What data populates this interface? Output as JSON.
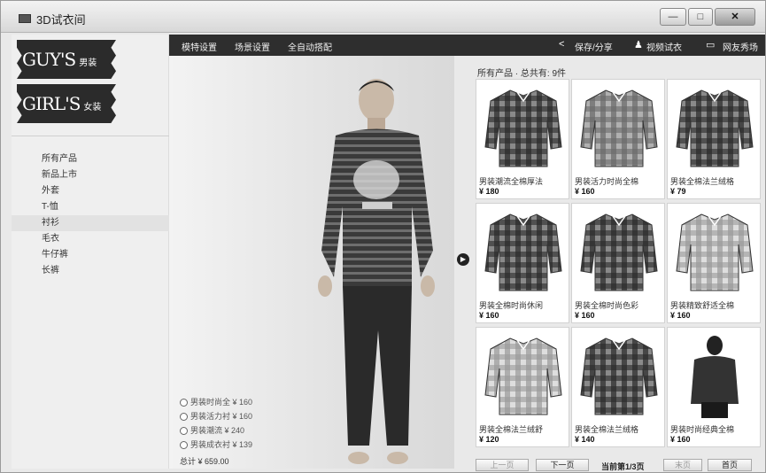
{
  "window": {
    "title": "3D试衣间",
    "min": "—",
    "max": "□",
    "close": "✕"
  },
  "brands": [
    {
      "name": "GUY'S",
      "sub": "男装"
    },
    {
      "name": "GIRL'S",
      "sub": "女装"
    }
  ],
  "categories": [
    "所有产品",
    "新品上市",
    "外套",
    "T-恤",
    "衬衫",
    "毛衣",
    "牛仔裤",
    "长裤"
  ],
  "active_category": "衬衫",
  "toolbar": {
    "items": [
      "模特设置",
      "场景设置",
      "全自动搭配"
    ],
    "share": "保存/分享",
    "video": "视频试衣",
    "friends": "网友秀场"
  },
  "outfit": {
    "items": [
      "男装时尚全 ¥ 160",
      "男装活力衬 ¥ 160",
      "男装潮流 ¥ 240",
      "男装成衣衬 ¥ 139"
    ],
    "total": "总计 ¥ 659.00"
  },
  "products": {
    "header": "所有产品 · 总共有: 9件",
    "items": [
      {
        "name": "男装潮流全棉厚法",
        "price": "¥ 180",
        "tone": "dark"
      },
      {
        "name": "男装活力时尚全棉",
        "price": "¥ 160",
        "tone": "mid"
      },
      {
        "name": "男装全棉法兰绒格",
        "price": "¥ 79",
        "tone": "dark"
      },
      {
        "name": "男装全棉时尚休闲",
        "price": "¥ 160",
        "tone": "dark"
      },
      {
        "name": "男装全棉时尚色彩",
        "price": "¥ 160",
        "tone": "dark"
      },
      {
        "name": "男装精致舒适全棉",
        "price": "¥ 160",
        "tone": "light"
      },
      {
        "name": "男装全棉法兰绒舒",
        "price": "¥ 120",
        "tone": "light"
      },
      {
        "name": "男装全棉法兰绒格",
        "price": "¥ 140",
        "tone": "dark"
      },
      {
        "name": "男装时尚经典全棉",
        "price": "¥ 160",
        "tone": "model"
      }
    ]
  },
  "pager": {
    "prev": "上一页",
    "next": "下一页",
    "info": "当前第1/3页",
    "last": "末页",
    "first": "首页"
  }
}
